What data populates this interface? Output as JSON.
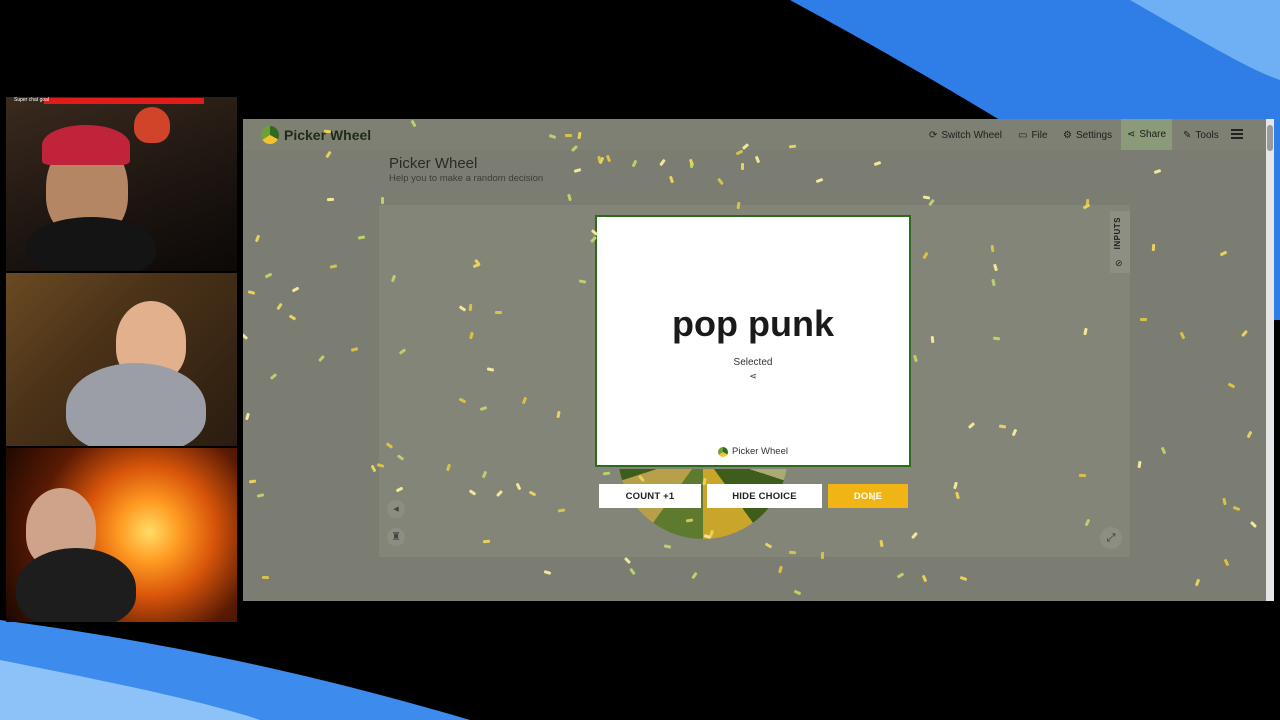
{
  "browser": {
    "logo_text": "Picker Wheel",
    "nav": [
      {
        "icon": "switch-icon",
        "glyph": "⟳",
        "label": "Switch Wheel"
      },
      {
        "icon": "folder-icon",
        "glyph": "▭",
        "label": "File"
      },
      {
        "icon": "gear-icon",
        "glyph": "⚙",
        "label": "Settings"
      },
      {
        "icon": "share-icon",
        "glyph": "⋖",
        "label": "Share"
      },
      {
        "icon": "tools-icon",
        "glyph": "✎",
        "label": "Tools"
      }
    ]
  },
  "page": {
    "title": "Picker Wheel",
    "subtitle": "Help you to make a random decision"
  },
  "stage": {
    "inputs_tab": "INPUTS",
    "result": "pop punk",
    "selected_label": "Selected",
    "card_brand": "Picker Wheel",
    "buttons": {
      "count": "COUNT +1",
      "hide": "HIDE CHOICE",
      "done": "DONE"
    }
  },
  "stream_overlay": {
    "bar_text": "Super chat goal"
  },
  "colors": {
    "accent_green": "#2e6a1c",
    "done_yellow": "#f0b414",
    "background_blue": "#2b78e4",
    "confetti_gold": "#e8d25a",
    "confetti_green": "#b7d36a"
  }
}
